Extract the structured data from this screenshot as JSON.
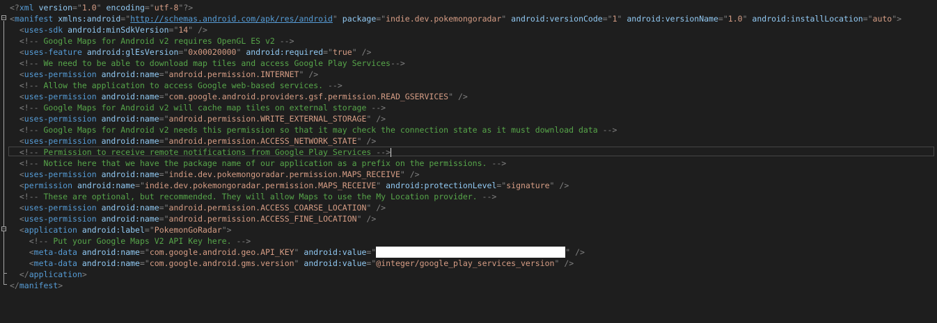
{
  "lines": [
    {
      "indent": "",
      "tokens": [
        {
          "c": "d",
          "t": "<?"
        },
        {
          "c": "t",
          "t": "xml"
        },
        {
          "c": "a",
          "t": " version"
        },
        {
          "c": "d",
          "t": "=\""
        },
        {
          "c": "v",
          "t": "1.0"
        },
        {
          "c": "d",
          "t": "\""
        },
        {
          "c": "a",
          "t": " encoding"
        },
        {
          "c": "d",
          "t": "=\""
        },
        {
          "c": "v",
          "t": "utf-8"
        },
        {
          "c": "d",
          "t": "\"?>"
        }
      ]
    },
    {
      "indent": "",
      "tokens": [
        {
          "c": "d",
          "t": "<"
        },
        {
          "c": "t",
          "t": "manifest"
        },
        {
          "c": "a",
          "t": " xmlns:android"
        },
        {
          "c": "d",
          "t": "=\""
        },
        {
          "c": "u",
          "t": "http://schemas.android.com/apk/res/android"
        },
        {
          "c": "d",
          "t": "\""
        },
        {
          "c": "a",
          "t": " package"
        },
        {
          "c": "d",
          "t": "=\""
        },
        {
          "c": "v",
          "t": "indie.dev.pokemongoradar"
        },
        {
          "c": "d",
          "t": "\""
        },
        {
          "c": "a",
          "t": " android:versionCode"
        },
        {
          "c": "d",
          "t": "=\""
        },
        {
          "c": "v",
          "t": "1"
        },
        {
          "c": "d",
          "t": "\""
        },
        {
          "c": "a",
          "t": " android:versionName"
        },
        {
          "c": "d",
          "t": "=\""
        },
        {
          "c": "v",
          "t": "1.0"
        },
        {
          "c": "d",
          "t": "\""
        },
        {
          "c": "a",
          "t": " android:installLocation"
        },
        {
          "c": "d",
          "t": "=\""
        },
        {
          "c": "v",
          "t": "auto"
        },
        {
          "c": "d",
          "t": "\">"
        }
      ]
    },
    {
      "indent": "  ",
      "tokens": [
        {
          "c": "d",
          "t": "<"
        },
        {
          "c": "t",
          "t": "uses-sdk"
        },
        {
          "c": "a",
          "t": " android:minSdkVersion"
        },
        {
          "c": "d",
          "t": "=\""
        },
        {
          "c": "v",
          "t": "14"
        },
        {
          "c": "d",
          "t": "\" />"
        }
      ]
    },
    {
      "indent": "  ",
      "tokens": [
        {
          "c": "d",
          "t": "<!--"
        },
        {
          "c": "c",
          "t": " Google Maps for Android v2 requires OpenGL ES v2 "
        },
        {
          "c": "d",
          "t": "-->"
        }
      ]
    },
    {
      "indent": "  ",
      "tokens": [
        {
          "c": "d",
          "t": "<"
        },
        {
          "c": "t",
          "t": "uses-feature"
        },
        {
          "c": "a",
          "t": " android:glEsVersion"
        },
        {
          "c": "d",
          "t": "=\""
        },
        {
          "c": "v",
          "t": "0x00020000"
        },
        {
          "c": "d",
          "t": "\""
        },
        {
          "c": "a",
          "t": " android:required"
        },
        {
          "c": "d",
          "t": "=\""
        },
        {
          "c": "v",
          "t": "true"
        },
        {
          "c": "d",
          "t": "\" />"
        }
      ]
    },
    {
      "indent": "  ",
      "tokens": [
        {
          "c": "d",
          "t": "<!--"
        },
        {
          "c": "c",
          "t": " We need to be able to download map tiles and access Google Play Services"
        },
        {
          "c": "d",
          "t": "-->"
        }
      ]
    },
    {
      "indent": "  ",
      "tokens": [
        {
          "c": "d",
          "t": "<"
        },
        {
          "c": "t",
          "t": "uses-permission"
        },
        {
          "c": "a",
          "t": " android:name"
        },
        {
          "c": "d",
          "t": "=\""
        },
        {
          "c": "v",
          "t": "android.permission.INTERNET"
        },
        {
          "c": "d",
          "t": "\" />"
        }
      ]
    },
    {
      "indent": "  ",
      "tokens": [
        {
          "c": "d",
          "t": "<!--"
        },
        {
          "c": "c",
          "t": " Allow the application to access Google web-based services. "
        },
        {
          "c": "d",
          "t": "-->"
        }
      ]
    },
    {
      "indent": "  ",
      "tokens": [
        {
          "c": "d",
          "t": "<"
        },
        {
          "c": "t",
          "t": "uses-permission"
        },
        {
          "c": "a",
          "t": " android:name"
        },
        {
          "c": "d",
          "t": "=\""
        },
        {
          "c": "v",
          "t": "com.google.android.providers.gsf.permission.READ_GSERVICES"
        },
        {
          "c": "d",
          "t": "\" />"
        }
      ]
    },
    {
      "indent": "  ",
      "tokens": [
        {
          "c": "d",
          "t": "<!--"
        },
        {
          "c": "c",
          "t": " Google Maps for Android v2 will cache map tiles on external storage "
        },
        {
          "c": "d",
          "t": "-->"
        }
      ]
    },
    {
      "indent": "  ",
      "tokens": [
        {
          "c": "d",
          "t": "<"
        },
        {
          "c": "t",
          "t": "uses-permission"
        },
        {
          "c": "a",
          "t": " android:name"
        },
        {
          "c": "d",
          "t": "=\""
        },
        {
          "c": "v",
          "t": "android.permission.WRITE_EXTERNAL_STORAGE"
        },
        {
          "c": "d",
          "t": "\" />"
        }
      ]
    },
    {
      "indent": "  ",
      "tokens": [
        {
          "c": "d",
          "t": "<!--"
        },
        {
          "c": "c",
          "t": " Google Maps for Android v2 needs this permission so that it may check the connection state as it must download data "
        },
        {
          "c": "d",
          "t": "-->"
        }
      ]
    },
    {
      "indent": "  ",
      "tokens": [
        {
          "c": "d",
          "t": "<"
        },
        {
          "c": "t",
          "t": "uses-permission"
        },
        {
          "c": "a",
          "t": " android:name"
        },
        {
          "c": "d",
          "t": "=\""
        },
        {
          "c": "v",
          "t": "android.permission.ACCESS_NETWORK_STATE"
        },
        {
          "c": "d",
          "t": "\" />"
        }
      ]
    },
    {
      "indent": "  ",
      "caret": true,
      "tokens": [
        {
          "c": "d",
          "t": "<!--"
        },
        {
          "c": "c",
          "t": " Permission to receive remote notifications from Google Play Services "
        },
        {
          "c": "d",
          "t": "-->"
        }
      ]
    },
    {
      "indent": "  ",
      "tokens": [
        {
          "c": "d",
          "t": "<!--"
        },
        {
          "c": "c",
          "t": " Notice here that we have the package name of our application as a prefix on the permissions. "
        },
        {
          "c": "d",
          "t": "-->"
        }
      ]
    },
    {
      "indent": "  ",
      "tokens": [
        {
          "c": "d",
          "t": "<"
        },
        {
          "c": "t",
          "t": "uses-permission"
        },
        {
          "c": "a",
          "t": " android:name"
        },
        {
          "c": "d",
          "t": "=\""
        },
        {
          "c": "v",
          "t": "indie.dev.pokemongoradar.permission.MAPS_RECEIVE"
        },
        {
          "c": "d",
          "t": "\" />"
        }
      ]
    },
    {
      "indent": "  ",
      "tokens": [
        {
          "c": "d",
          "t": "<"
        },
        {
          "c": "t",
          "t": "permission"
        },
        {
          "c": "a",
          "t": " android:name"
        },
        {
          "c": "d",
          "t": "=\""
        },
        {
          "c": "v",
          "t": "indie.dev.pokemongoradar.permission.MAPS_RECEIVE"
        },
        {
          "c": "d",
          "t": "\""
        },
        {
          "c": "a",
          "t": " android:protectionLevel"
        },
        {
          "c": "d",
          "t": "=\""
        },
        {
          "c": "v",
          "t": "signature"
        },
        {
          "c": "d",
          "t": "\" />"
        }
      ]
    },
    {
      "indent": "  ",
      "tokens": [
        {
          "c": "d",
          "t": "<!--"
        },
        {
          "c": "c",
          "t": " These are optional, but recommended. They will allow Maps to use the My Location provider. "
        },
        {
          "c": "d",
          "t": "-->"
        }
      ]
    },
    {
      "indent": "  ",
      "tokens": [
        {
          "c": "d",
          "t": "<"
        },
        {
          "c": "t",
          "t": "uses-permission"
        },
        {
          "c": "a",
          "t": " android:name"
        },
        {
          "c": "d",
          "t": "=\""
        },
        {
          "c": "v",
          "t": "android.permission.ACCESS_COARSE_LOCATION"
        },
        {
          "c": "d",
          "t": "\" />"
        }
      ]
    },
    {
      "indent": "  ",
      "tokens": [
        {
          "c": "d",
          "t": "<"
        },
        {
          "c": "t",
          "t": "uses-permission"
        },
        {
          "c": "a",
          "t": " android:name"
        },
        {
          "c": "d",
          "t": "=\""
        },
        {
          "c": "v",
          "t": "android.permission.ACCESS_FINE_LOCATION"
        },
        {
          "c": "d",
          "t": "\" />"
        }
      ]
    },
    {
      "indent": "  ",
      "tokens": [
        {
          "c": "d",
          "t": "<"
        },
        {
          "c": "t",
          "t": "application"
        },
        {
          "c": "a",
          "t": " android:label"
        },
        {
          "c": "d",
          "t": "=\""
        },
        {
          "c": "v",
          "t": "PokemonGoRadar"
        },
        {
          "c": "d",
          "t": "\">"
        }
      ]
    },
    {
      "indent": "    ",
      "tokens": [
        {
          "c": "d",
          "t": "<!--"
        },
        {
          "c": "c",
          "t": " Put your Google Maps V2 API Key here. "
        },
        {
          "c": "d",
          "t": "-->"
        }
      ]
    },
    {
      "indent": "    ",
      "tokens": [
        {
          "c": "d",
          "t": "<"
        },
        {
          "c": "t",
          "t": "meta-data"
        },
        {
          "c": "a",
          "t": " android:name"
        },
        {
          "c": "d",
          "t": "=\""
        },
        {
          "c": "v",
          "t": "com.google.android.geo.API_KEY"
        },
        {
          "c": "d",
          "t": "\""
        },
        {
          "c": "a",
          "t": " android:value"
        },
        {
          "c": "d",
          "t": "=\""
        },
        {
          "c": "redact",
          "t": ""
        },
        {
          "c": "d",
          "t": "\" />"
        }
      ]
    },
    {
      "indent": "    ",
      "tokens": [
        {
          "c": "d",
          "t": "<"
        },
        {
          "c": "t",
          "t": "meta-data"
        },
        {
          "c": "a",
          "t": " android:name"
        },
        {
          "c": "d",
          "t": "=\""
        },
        {
          "c": "v",
          "t": "com.google.android.gms.version"
        },
        {
          "c": "d",
          "t": "\""
        },
        {
          "c": "a",
          "t": " android:value"
        },
        {
          "c": "d",
          "t": "=\""
        },
        {
          "c": "v",
          "t": "@integer/google_play_services_version"
        },
        {
          "c": "d",
          "t": "\" />"
        }
      ]
    },
    {
      "indent": "  ",
      "tokens": [
        {
          "c": "d",
          "t": "</"
        },
        {
          "c": "t",
          "t": "application"
        },
        {
          "c": "d",
          "t": ">"
        }
      ]
    },
    {
      "indent": "",
      "tokens": [
        {
          "c": "d",
          "t": "</"
        },
        {
          "c": "t",
          "t": "manifest"
        },
        {
          "c": "d",
          "t": ">"
        }
      ]
    }
  ],
  "colors": {
    "background": "#1e1e1e",
    "delimiter": "#808080",
    "tag": "#569cd6",
    "attribute": "#92caf4",
    "value": "#d69d85",
    "comment": "#57a64a"
  }
}
